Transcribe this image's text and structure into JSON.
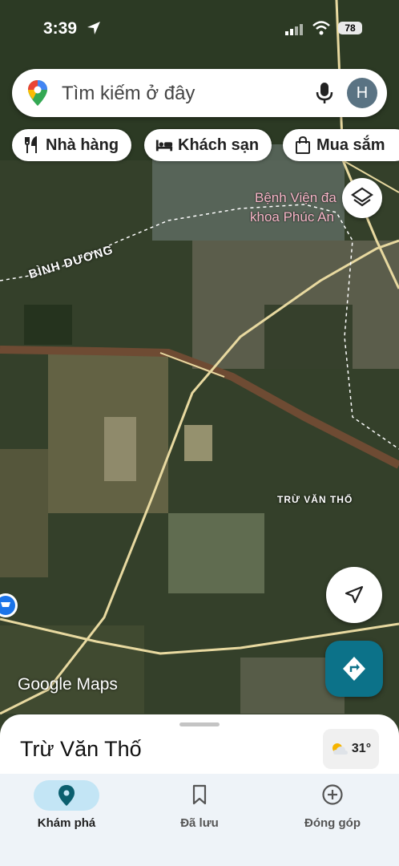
{
  "status_bar": {
    "time": "3:39",
    "battery": "78"
  },
  "search": {
    "placeholder": "Tìm kiếm ở đây",
    "avatar_letter": "H"
  },
  "chips": [
    {
      "label": "Nhà hàng",
      "icon": "fork-knife-icon"
    },
    {
      "label": "Khách sạn",
      "icon": "bed-icon"
    },
    {
      "label": "Mua sắm",
      "icon": "shopping-bag-icon"
    }
  ],
  "map_labels": {
    "hospital_line1": "Bệnh Viện đa",
    "hospital_line2": "khoa Phúc An",
    "province": "BÌNH DƯƠNG",
    "village": "TRỪ VĂN THỐ"
  },
  "brand": "Google Maps",
  "place_sheet": {
    "title": "Trừ Văn Thố",
    "temperature": "31°",
    "weather_icon": "partly-cloudy-icon"
  },
  "bottom_nav": [
    {
      "label": "Khám phá",
      "icon": "location-pin-icon",
      "active": true
    },
    {
      "label": "Đã lưu",
      "icon": "bookmark-icon",
      "active": false
    },
    {
      "label": "Đóng góp",
      "icon": "add-circle-icon",
      "active": false
    }
  ],
  "colors": {
    "accent": "#0c7289",
    "active_tab": "#c3e5f5",
    "hospital_label": "#f7b6c8",
    "road": "#e8d9a0"
  }
}
